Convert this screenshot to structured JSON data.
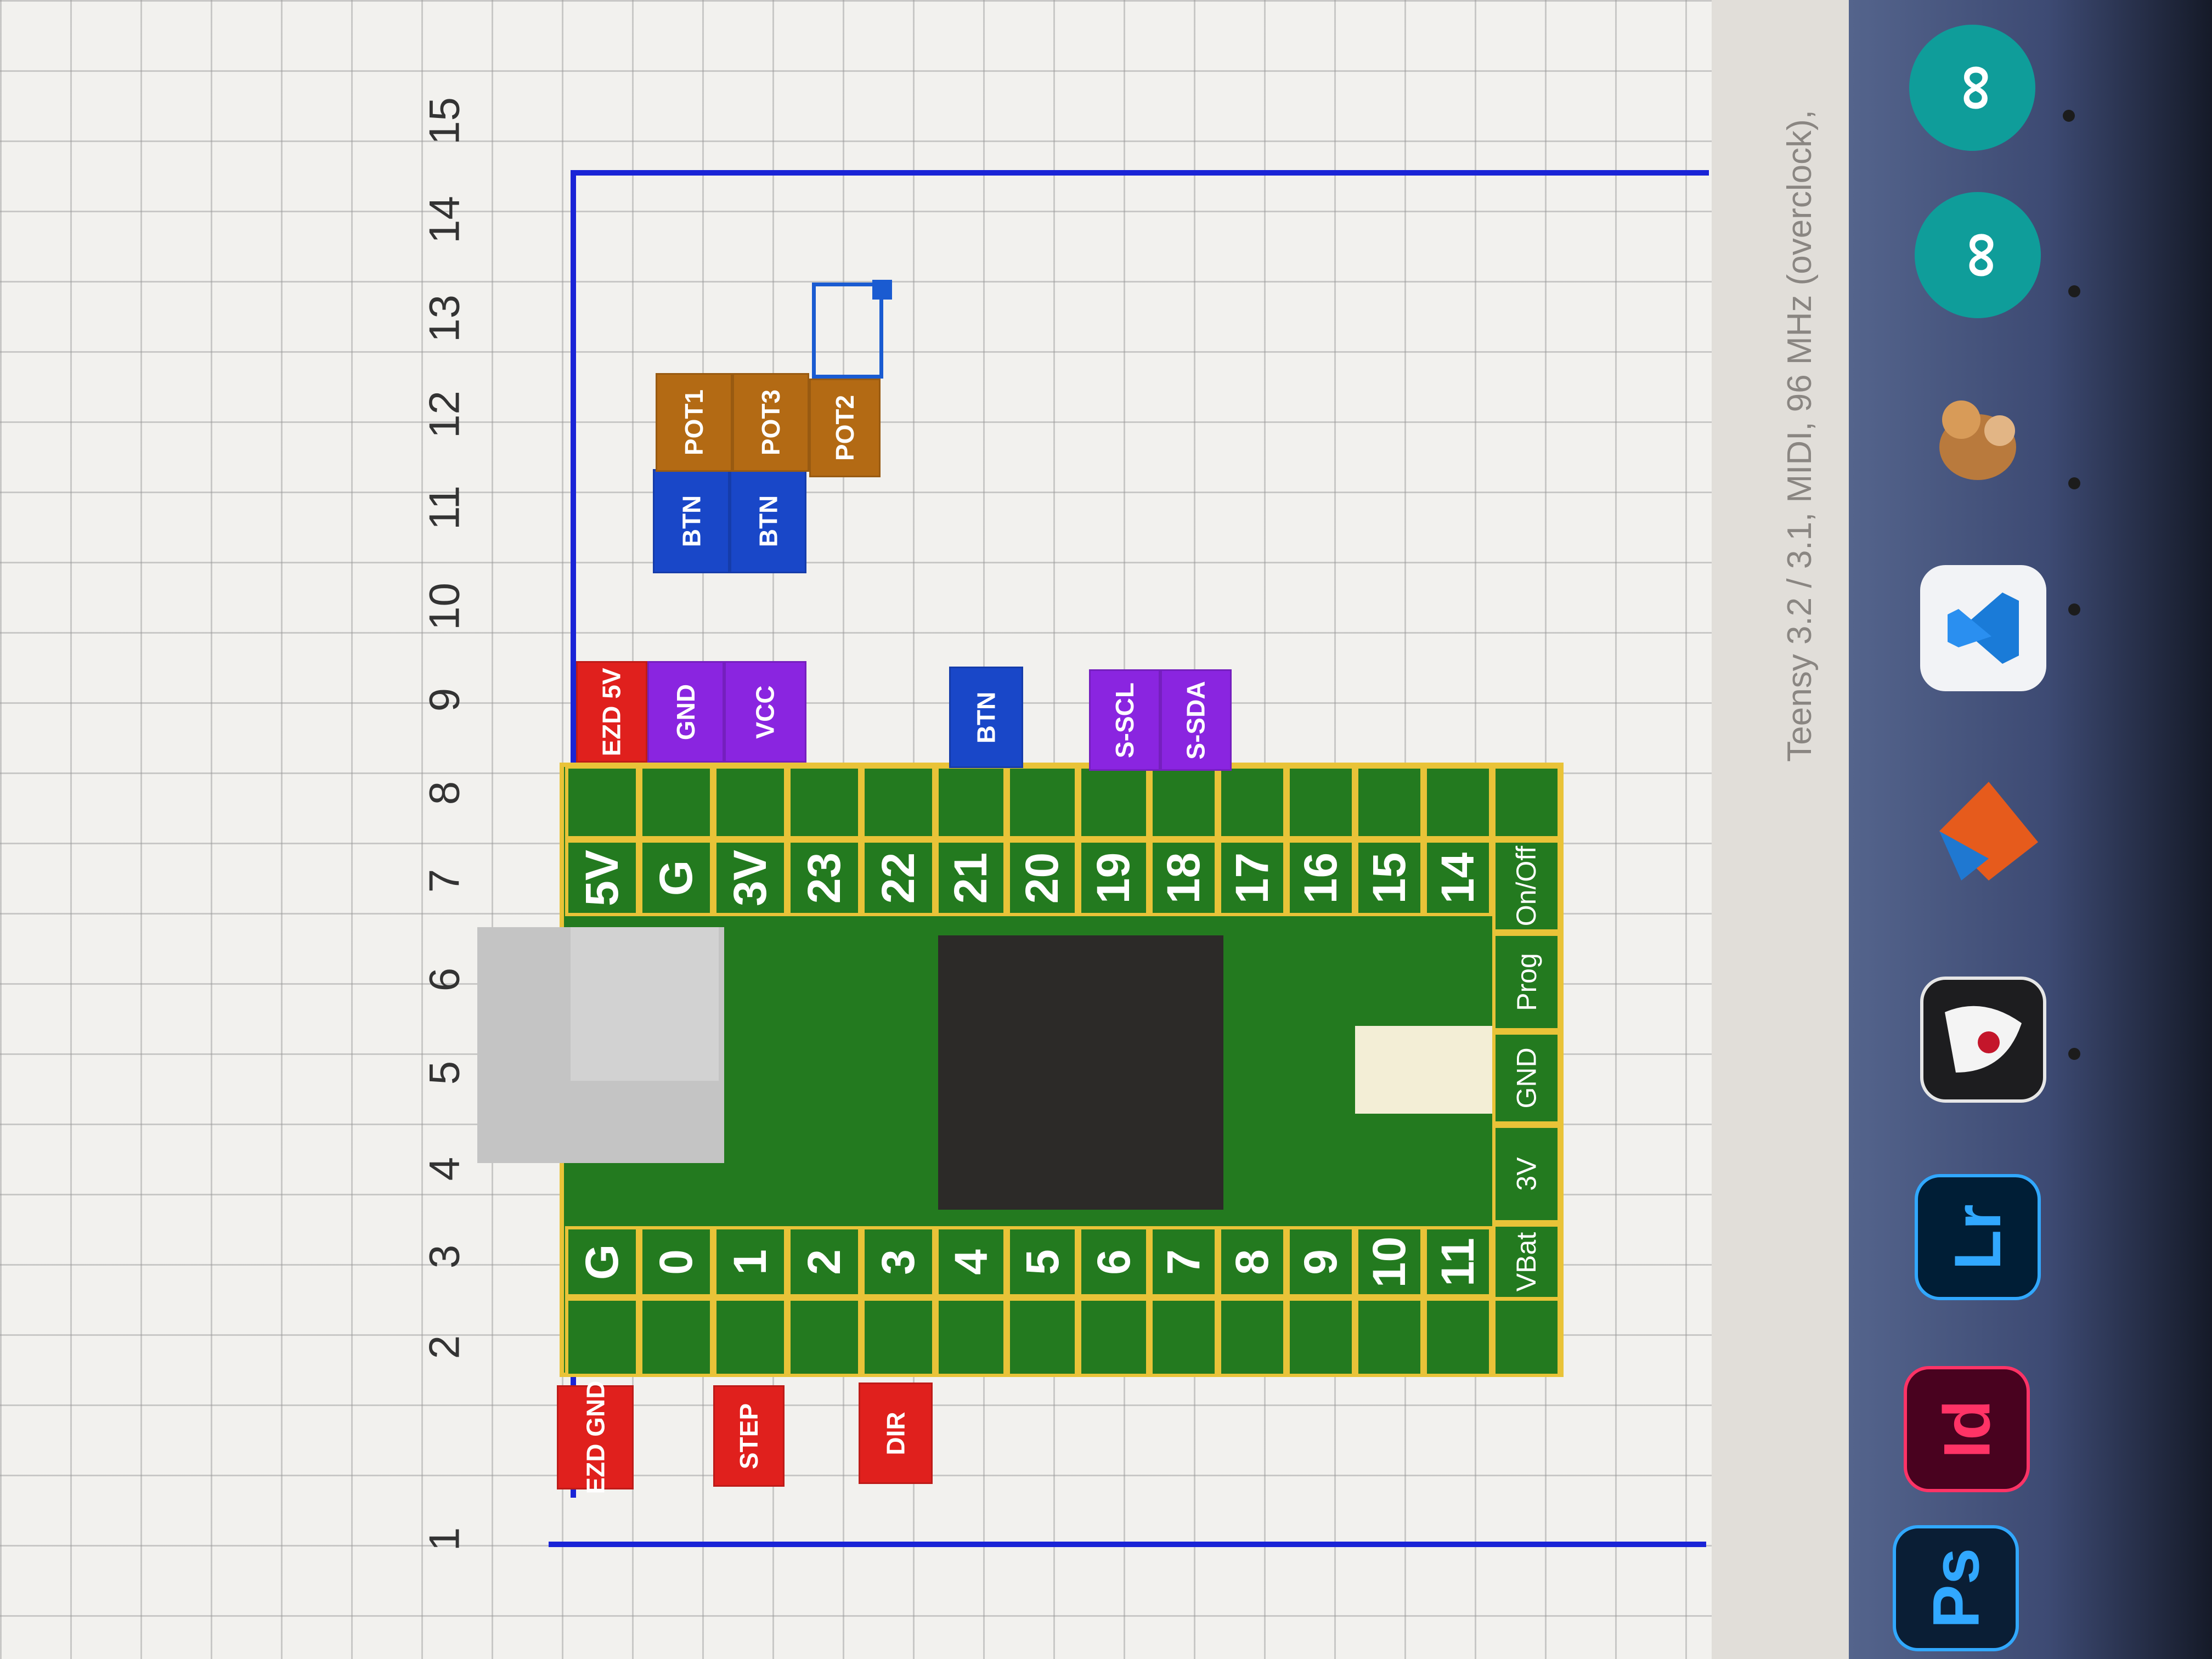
{
  "spreadsheet": {
    "column_numbers": [
      "1",
      "2",
      "3",
      "4",
      "5",
      "6",
      "7",
      "8",
      "9",
      "10",
      "11",
      "12",
      "13",
      "14",
      "15"
    ]
  },
  "board": {
    "left_pins": [
      "G",
      "0",
      "1",
      "2",
      "3",
      "4",
      "5",
      "6",
      "7",
      "8",
      "9",
      "10",
      "11"
    ],
    "right_pins": [
      "5V",
      "G",
      "3V",
      "23",
      "22",
      "21",
      "20",
      "19",
      "18",
      "17",
      "16",
      "15",
      "14"
    ],
    "bottom_pins": [
      "VBat",
      "3V",
      "GND",
      "Prog",
      "On/Off"
    ]
  },
  "tags": {
    "ezd_gnd": "EZD GND",
    "step": "STEP",
    "dir": "DIR",
    "ezd_5v": "EZD 5V",
    "gnd": "GND",
    "vcc": "VCC",
    "btn_pin21": "BTN",
    "s_scl": "S-SCL",
    "s_sda": "S-SDA",
    "btn_1": "BTN",
    "btn_2": "BTN",
    "pot1": "POT1",
    "pot3": "POT3",
    "pot2": "POT2"
  },
  "status_bar": {
    "text": "Teensy 3.2 / 3.1, MIDI, 96 MHz (overclock),"
  },
  "dock": {
    "apps": [
      {
        "name": "Photoshop",
        "label": "Ps",
        "color": "#31a8ff"
      },
      {
        "name": "InDesign",
        "label": "Id",
        "color": "#ff3366"
      },
      {
        "name": "Lightroom",
        "label": "Lr",
        "color": "#31a8ff"
      },
      {
        "name": "Arduino",
        "label": "∞",
        "color": "#0f9d9a"
      },
      {
        "name": "Arduino 2",
        "label": "∞",
        "color": "#0f9d9a"
      }
    ]
  },
  "colors": {
    "board_green": "#237a1f",
    "pin_border": "#e9c338",
    "outline_blue": "#1a24d6",
    "tag_red": "#e0201d",
    "tag_purple": "#8a25e0",
    "tag_blue": "#1947c8",
    "tag_brown": "#b36a14"
  }
}
